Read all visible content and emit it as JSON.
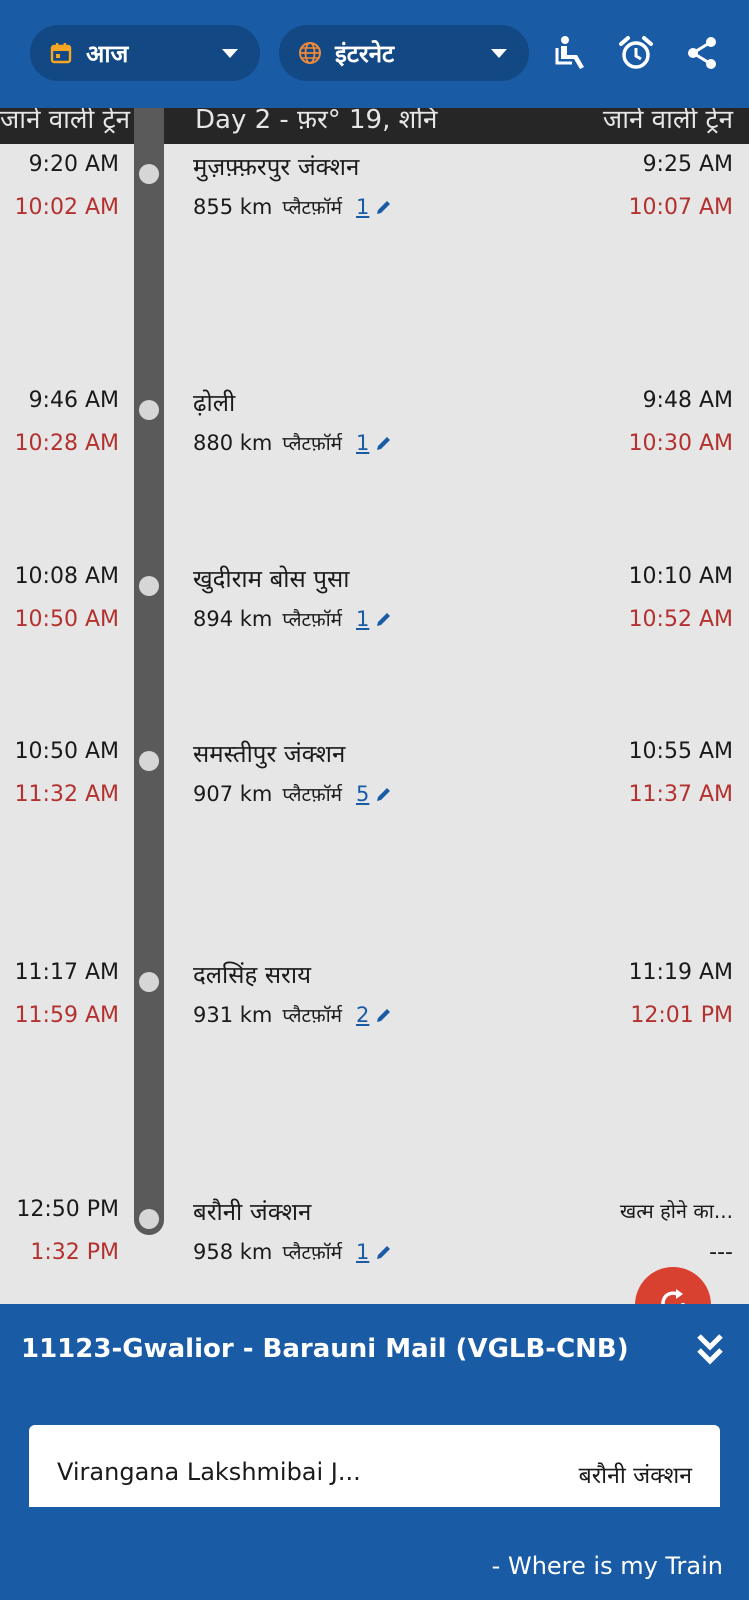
{
  "toolbar": {
    "date_label": "आज",
    "source_label": "इंटरनेट"
  },
  "column_header": {
    "left": "जाने वाली ट्रेन",
    "middle": "Day 2 - फ़र° 19, शनि",
    "right": "जाने वाली ट्रेन"
  },
  "stops": [
    {
      "arr_sched": "9:20 AM",
      "arr_actual": "10:02 AM",
      "name": "मुज़फ़्फ़रपुर जंक्शन",
      "km": "855 km",
      "platform_label": "प्लैटफ़ॉर्म",
      "platform": "1",
      "dep_sched": "9:25 AM",
      "dep_actual": "10:07 AM"
    },
    {
      "arr_sched": "9:46 AM",
      "arr_actual": "10:28 AM",
      "name": "ढ़ोली",
      "km": "880 km",
      "platform_label": "प्लैटफ़ॉर्म",
      "platform": "1",
      "dep_sched": "9:48 AM",
      "dep_actual": "10:30 AM"
    },
    {
      "arr_sched": "10:08 AM",
      "arr_actual": "10:50 AM",
      "name": "खुदीराम बोस पुसा",
      "km": "894 km",
      "platform_label": "प्लैटफ़ॉर्म",
      "platform": "1",
      "dep_sched": "10:10 AM",
      "dep_actual": "10:52 AM"
    },
    {
      "arr_sched": "10:50 AM",
      "arr_actual": "11:32 AM",
      "name": "समस्तीपुर जंक्शन",
      "km": "907 km",
      "platform_label": "प्लैटफ़ॉर्म",
      "platform": "5",
      "dep_sched": "10:55 AM",
      "dep_actual": "11:37 AM"
    },
    {
      "arr_sched": "11:17 AM",
      "arr_actual": "11:59 AM",
      "name": "दलसिंह सराय",
      "km": "931 km",
      "platform_label": "प्लैटफ़ॉर्म",
      "platform": "2",
      "dep_sched": "11:19 AM",
      "dep_actual": "12:01 PM"
    },
    {
      "arr_sched": "12:50 PM",
      "arr_actual": "1:32 PM",
      "name": "बरौनी जंक्शन",
      "km": "958 km",
      "platform_label": "प्लैटफ़ॉर्म",
      "platform": "1",
      "dep_sched": "खत्म होने का...",
      "dep_actual": "---"
    }
  ],
  "train": {
    "title": "11123-Gwalior - Barauni Mail (VGLB-CNB)",
    "from": "Virangana Lakshmibai J...",
    "to": "बरौनी जंक्शन"
  },
  "brand": "- Where is my Train",
  "colors": {
    "primary": "#1a5ba6",
    "pill": "#124883",
    "late_time": "#b3312f",
    "fab": "#d8412f",
    "track": "#5a5a5a"
  }
}
